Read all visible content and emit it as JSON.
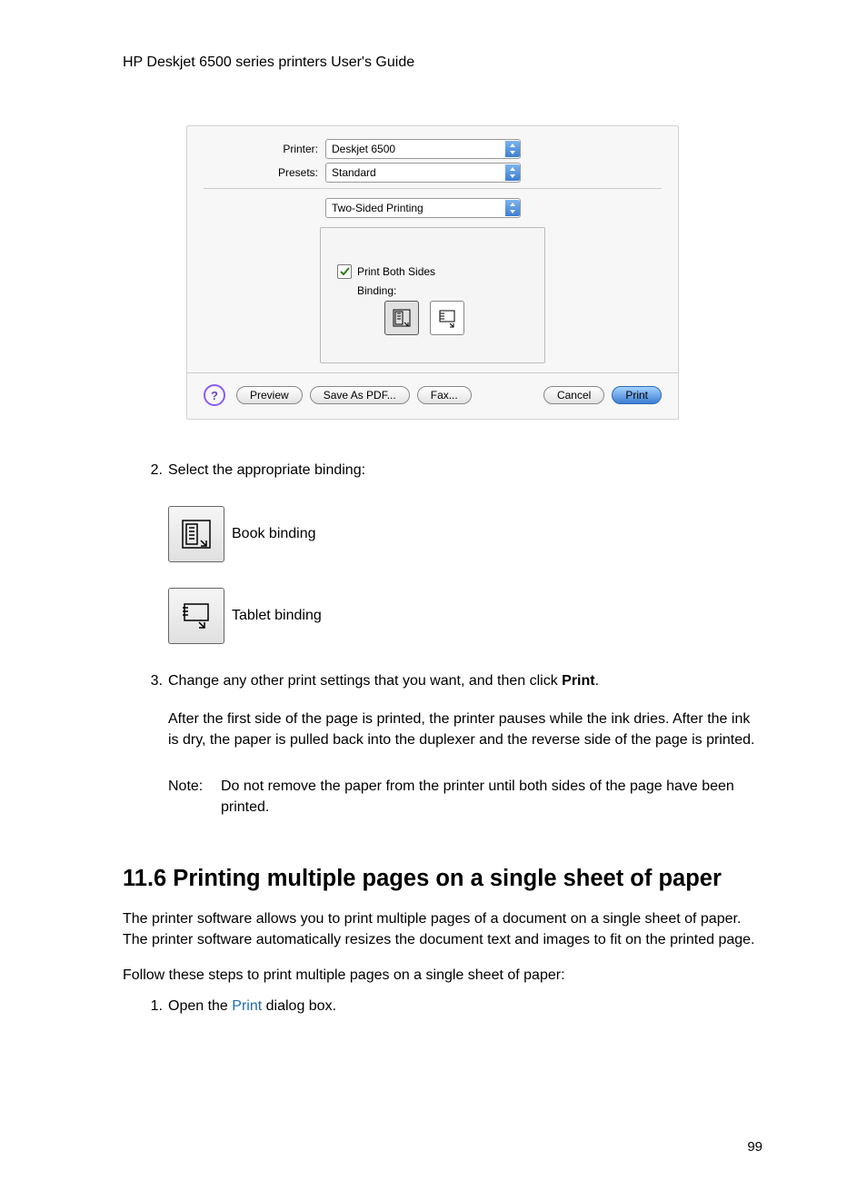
{
  "header": {
    "title": "HP Deskjet 6500 series printers User's Guide"
  },
  "dialog": {
    "printer_label": "Printer:",
    "printer_value": "Deskjet 6500",
    "presets_label": "Presets:",
    "presets_value": "Standard",
    "panel_value": "Two-Sided Printing",
    "print_both_sides": "Print Both Sides",
    "binding_label": "Binding:",
    "help_glyph": "?",
    "buttons": {
      "preview": "Preview",
      "save_pdf": "Save As PDF...",
      "fax": "Fax...",
      "cancel": "Cancel",
      "print": "Print"
    }
  },
  "step2": {
    "num": "2.",
    "text": "Select the appropriate binding:"
  },
  "book_binding": "Book binding",
  "tablet_binding": "Tablet binding",
  "step3": {
    "num": "3.",
    "text_a": "Change any other print settings that you want, and then click ",
    "text_b": "Print",
    "text_c": "."
  },
  "step3_para": "After the first side of the page is printed, the printer pauses while the ink dries. After the ink is dry, the paper is pulled back into the duplexer and the reverse side of the page is printed.",
  "note": {
    "label": "Note:",
    "body": "Do not remove the paper from the printer until both sides of the page have been printed."
  },
  "heading": "11.6  Printing multiple pages on a single sheet of paper",
  "para1": "The printer software allows you to print multiple pages of a document on a single sheet of paper. The printer software automatically resizes the document text and images to fit on the printed page.",
  "para2": "Follow these steps to print multiple pages on a single sheet of paper:",
  "step_new1": {
    "num": "1.",
    "a": "Open the ",
    "link": "Print",
    "b": " dialog box."
  },
  "page_number": "99"
}
